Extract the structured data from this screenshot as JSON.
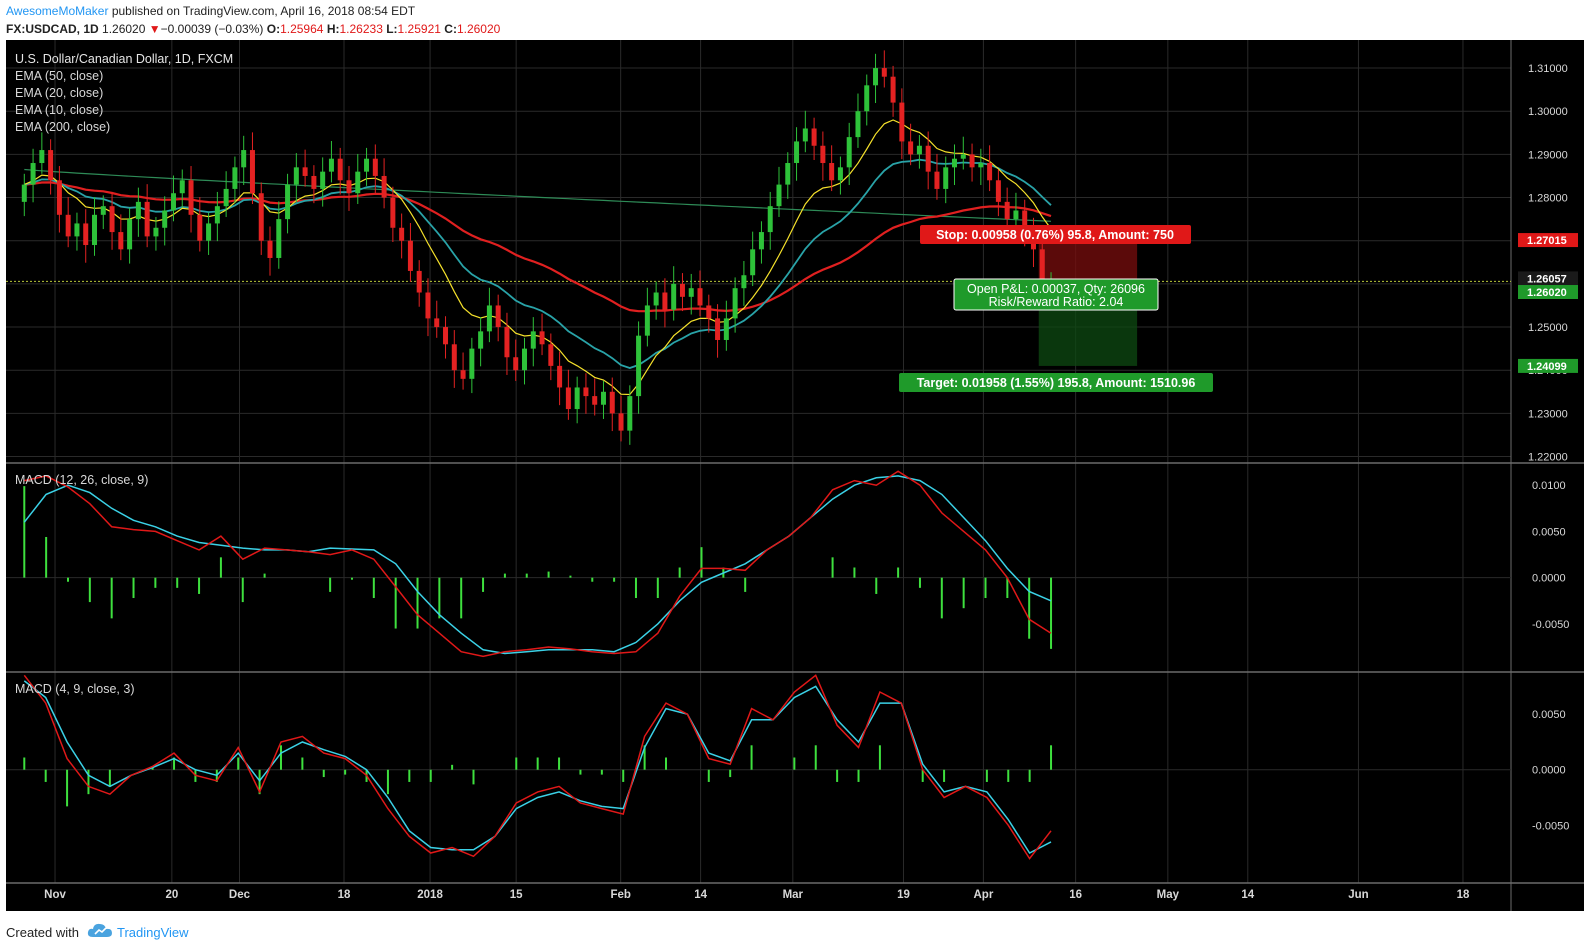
{
  "header": {
    "author": "AwesomeMoMaker",
    "published": "published on TradingView.com, April 16, 2018 08:54 EDT",
    "symbol": "FX:USDCAD, 1D",
    "last": "1.26020",
    "arrow": "▼",
    "change": "−0.00039 (−0.03%)",
    "o_label": "O:",
    "o_value": "1.25964",
    "h_label": "H:",
    "h_value": "1.26233",
    "l_label": "L:",
    "l_value": "1.25921",
    "c_label": "C:",
    "c_value": "1.26020"
  },
  "legend": {
    "title": "U.S. Dollar/Canadian Dollar, 1D, FXCM",
    "ema50": "EMA (50, close)",
    "ema20": "EMA (20, close)",
    "ema10": "EMA (10, close)",
    "ema200": "EMA (200, close)",
    "macd1": "MACD (12, 26, close, 9)",
    "macd2": "MACD (4, 9, close, 3)"
  },
  "price_axis": {
    "ticks": [
      "1.31000",
      "1.30000",
      "1.29000",
      "1.28000",
      "1.27000",
      "1.26000",
      "1.25000",
      "1.24000",
      "1.23000",
      "1.22000"
    ],
    "badges": [
      {
        "text": "1.27015",
        "color": "#e01818"
      },
      {
        "text": "1.26057",
        "color": "#1a1a1a"
      },
      {
        "text": "1.26020",
        "color": "#1f9a2a"
      },
      {
        "text": "1.24099",
        "color": "#1f9a2a"
      }
    ]
  },
  "macd1_axis": [
    "0.0100",
    "0.0050",
    "0.0000",
    "-0.0050"
  ],
  "macd2_axis": [
    "0.0050",
    "0.0000",
    "-0.0050"
  ],
  "time_axis": [
    "Nov",
    "20",
    "Dec",
    "18",
    "2018",
    "15",
    "Feb",
    "14",
    "Mar",
    "19",
    "Apr",
    "16",
    "May",
    "14",
    "Jun",
    "18"
  ],
  "position": {
    "stop_label": "Stop: 0.00958 (0.76%) 95.8, Amount: 750",
    "open_label": "Open P&L: 0.00037, Qty: 26096",
    "rr_label": "Risk/Reward Ratio: 2.04",
    "target_label": "Target: 0.01958 (1.55%) 195.8, Amount: 1510.96"
  },
  "colors": {
    "background": "#000000",
    "up": "#2ec23a",
    "down": "#e42222",
    "ema10": "#f5e12b",
    "ema20": "#29a3a8",
    "ema50": "#e02020",
    "ema200": "#2e8b57",
    "macd_line": "#e01818",
    "signal_line": "#3bd1e6",
    "hist": "#3ee03e"
  },
  "footer": {
    "created_with": "Created with",
    "brand": "TradingView"
  },
  "chart_data": [
    {
      "type": "candlestick",
      "title": "U.S. Dollar/Canadian Dollar, 1D, FXCM",
      "ylim": [
        1.2185,
        1.3165
      ],
      "x_range": [
        "2017-10-25",
        "2018-06-25"
      ],
      "candles_close": [
        1.283,
        1.288,
        1.291,
        1.284,
        1.276,
        1.271,
        1.274,
        1.269,
        1.276,
        1.278,
        1.272,
        1.268,
        1.275,
        1.279,
        1.271,
        1.273,
        1.277,
        1.281,
        1.284,
        1.276,
        1.27,
        1.274,
        1.278,
        1.282,
        1.287,
        1.291,
        1.281,
        1.27,
        1.266,
        1.275,
        1.283,
        1.287,
        1.285,
        1.282,
        1.286,
        1.289,
        1.284,
        1.281,
        1.286,
        1.289,
        1.285,
        1.28,
        1.273,
        1.27,
        1.263,
        1.258,
        1.252,
        1.25,
        1.246,
        1.24,
        1.238,
        1.245,
        1.249,
        1.255,
        1.25,
        1.243,
        1.24,
        1.245,
        1.249,
        1.246,
        1.241,
        1.236,
        1.231,
        1.236,
        1.234,
        1.232,
        1.235,
        1.23,
        1.226,
        1.234,
        1.248,
        1.255,
        1.258,
        1.254,
        1.26,
        1.257,
        1.259,
        1.255,
        1.252,
        1.247,
        1.252,
        1.259,
        1.262,
        1.268,
        1.272,
        1.278,
        1.283,
        1.288,
        1.293,
        1.296,
        1.292,
        1.288,
        1.284,
        1.287,
        1.294,
        1.3,
        1.306,
        1.31,
        1.308,
        1.302,
        1.293,
        1.29,
        1.292,
        1.286,
        1.282,
        1.287,
        1.289,
        1.29,
        1.287,
        1.288,
        1.284,
        1.279,
        1.275,
        1.277,
        1.272,
        1.268,
        1.261,
        1.2602
      ],
      "ema10_end": 1.268,
      "ema20_end": 1.274,
      "ema50_end": 1.2757,
      "ema200_end": 1.2745,
      "position": {
        "side": "long",
        "entry": 1.25983,
        "stop": 1.27015,
        "target": 1.24099,
        "note": "as labelled on chart"
      }
    },
    {
      "type": "line",
      "title": "MACD (12, 26, close, 9)",
      "ylim": [
        -0.0102,
        0.0124
      ],
      "series": [
        {
          "name": "MACD",
          "values": [
            0.0105,
            0.011,
            0.0098,
            0.008,
            0.0055,
            0.0052,
            0.005,
            0.004,
            0.003,
            0.0045,
            0.002,
            0.0032,
            0.003,
            0.0028,
            0.0025,
            0.003,
            0.002,
            -0.001,
            -0.004,
            -0.006,
            -0.008,
            -0.0085,
            -0.008,
            -0.0078,
            -0.0075,
            -0.0077,
            -0.008,
            -0.0082,
            -0.008,
            -0.006,
            -0.002,
            0.001,
            0.001,
            0.0008,
            0.003,
            0.0045,
            0.0065,
            0.0095,
            0.0105,
            0.01,
            0.0115,
            0.01,
            0.007,
            0.005,
            0.003,
            0.0,
            -0.0045,
            -0.006
          ]
        },
        {
          "name": "Signal",
          "values": [
            0.006,
            0.009,
            0.01,
            0.0092,
            0.0075,
            0.0062,
            0.0055,
            0.0045,
            0.0038,
            0.0035,
            0.0032,
            0.003,
            0.003,
            0.0028,
            0.0032,
            0.0031,
            0.003,
            0.0015,
            -0.0015,
            -0.004,
            -0.006,
            -0.0078,
            -0.0082,
            -0.008,
            -0.0078,
            -0.0078,
            -0.0078,
            -0.008,
            -0.007,
            -0.005,
            -0.0025,
            -0.0005,
            0.0005,
            0.0015,
            0.003,
            0.0045,
            0.0065,
            0.0085,
            0.01,
            0.0108,
            0.011,
            0.0105,
            0.009,
            0.0065,
            0.004,
            0.001,
            -0.0015,
            -0.0025
          ]
        }
      ]
    },
    {
      "type": "line",
      "title": "MACD (4, 9, close, 3)",
      "ylim": [
        -0.0102,
        0.0088
      ],
      "series": [
        {
          "name": "MACD",
          "values": [
            0.0085,
            0.006,
            0.001,
            -0.0015,
            -0.0022,
            -0.0005,
            0.0003,
            0.0015,
            -0.0005,
            -0.001,
            0.002,
            -0.002,
            0.0025,
            0.003,
            0.0015,
            0.001,
            -0.0005,
            -0.0035,
            -0.006,
            -0.0075,
            -0.007,
            -0.0078,
            -0.006,
            -0.003,
            -0.002,
            -0.0015,
            -0.003,
            -0.0035,
            -0.004,
            0.003,
            0.006,
            0.005,
            0.001,
            0.0005,
            0.0055,
            0.0045,
            0.007,
            0.0085,
            0.004,
            0.002,
            0.007,
            0.006,
            0.0,
            -0.0025,
            -0.0015,
            -0.0025,
            -0.005,
            -0.008,
            -0.0055
          ]
        },
        {
          "name": "Signal",
          "values": [
            0.008,
            0.0065,
            0.0025,
            -0.0005,
            -0.0015,
            -0.0005,
            0.0002,
            0.001,
            0.0,
            -0.0005,
            0.0015,
            -0.001,
            0.0015,
            0.0025,
            0.0018,
            0.0012,
            0.0,
            -0.0025,
            -0.0055,
            -0.007,
            -0.0072,
            -0.0072,
            -0.006,
            -0.0035,
            -0.0025,
            -0.002,
            -0.0028,
            -0.0033,
            -0.0035,
            0.002,
            0.0055,
            0.005,
            0.0015,
            0.0008,
            0.0045,
            0.0045,
            0.0065,
            0.0075,
            0.0045,
            0.0025,
            0.006,
            0.006,
            0.0005,
            -0.002,
            -0.0015,
            -0.002,
            -0.0045,
            -0.0075,
            -0.0065
          ]
        }
      ]
    }
  ]
}
